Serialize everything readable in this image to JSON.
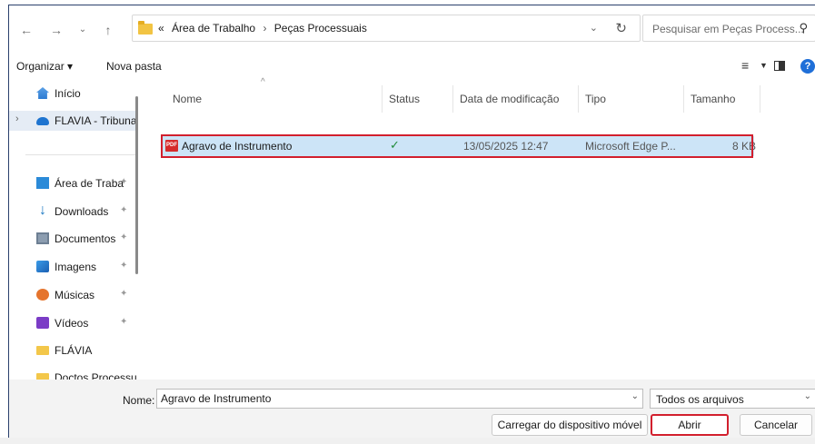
{
  "address": {
    "prefix": "«",
    "crumbs": [
      "Área de Trabalho",
      "Peças Processuais"
    ],
    "separator": "›"
  },
  "search": {
    "placeholder": "Pesquisar em Peças Process..."
  },
  "toolbar": {
    "organize_label": "Organizar ▾",
    "new_folder_label": "Nova pasta"
  },
  "sidebar": {
    "items": [
      {
        "label": "Início",
        "icon": "home-icon",
        "pinned": false
      },
      {
        "label": "FLAVIA - Tribuna",
        "icon": "cloud-icon",
        "pinned": false,
        "expandable": true
      },
      {
        "label": "Área de Traba",
        "icon": "desktop-icon",
        "pinned": true
      },
      {
        "label": "Downloads",
        "icon": "download-icon",
        "pinned": true
      },
      {
        "label": "Documentos",
        "icon": "documents-icon",
        "pinned": true
      },
      {
        "label": "Imagens",
        "icon": "images-icon",
        "pinned": true
      },
      {
        "label": "Músicas",
        "icon": "music-icon",
        "pinned": true
      },
      {
        "label": "Vídeos",
        "icon": "video-icon",
        "pinned": true
      },
      {
        "label": "FLÁVIA",
        "icon": "folder-icon",
        "pinned": false
      },
      {
        "label": "Doctos Processu",
        "icon": "folder-icon",
        "pinned": false
      }
    ]
  },
  "columns": [
    "Nome",
    "Status",
    "Data de modificação",
    "Tipo",
    "Tamanho"
  ],
  "files": [
    {
      "name": "Agravo de Instrumento",
      "status": "✓",
      "modified": "13/05/2025 12:47",
      "type": "Microsoft Edge P...",
      "size": "8 KB"
    }
  ],
  "bottom": {
    "name_label": "Nome:",
    "name_value": "Agravo de Instrumento",
    "file_type": "Todos os arquivos",
    "mobile_button": "Carregar do dispositivo móvel",
    "open_button": "Abrir",
    "cancel_button": "Cancelar"
  },
  "colors": {
    "selection": "#cce4f7",
    "highlight": "#d21f2d",
    "accent": "#1f6fd8"
  }
}
